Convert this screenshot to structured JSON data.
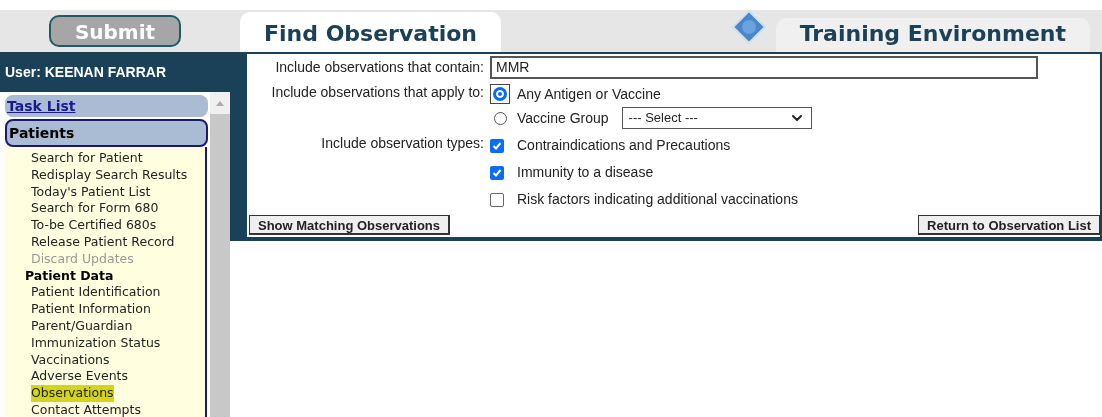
{
  "submit_button": "Submit",
  "tabs": [
    {
      "label": "Find Observation",
      "selected": true
    },
    {
      "label": "Training Environment",
      "selected": false
    }
  ],
  "sidebar": {
    "user": "User: KEENAN FARRAR",
    "task_list": "Task List",
    "section": "Patients",
    "items": [
      {
        "label": "Search for Patient",
        "kind": "link",
        "selected": false
      },
      {
        "label": "Redisplay Search Results",
        "kind": "link",
        "selected": false
      },
      {
        "label": "Today's Patient List",
        "kind": "link",
        "selected": false
      },
      {
        "label": "Search for Form 680",
        "kind": "link",
        "selected": false
      },
      {
        "label": "To-be Certified 680s",
        "kind": "link",
        "selected": false
      },
      {
        "label": "Release Patient Record",
        "kind": "link",
        "selected": false
      },
      {
        "label": "Discard Updates",
        "kind": "disabled",
        "selected": false
      },
      {
        "label": "Patient Data",
        "kind": "heading",
        "selected": false
      },
      {
        "label": "Patient Identification",
        "kind": "link",
        "selected": false
      },
      {
        "label": "Patient Information",
        "kind": "link",
        "selected": false
      },
      {
        "label": "Parent/Guardian",
        "kind": "link",
        "selected": false
      },
      {
        "label": "Immunization Status",
        "kind": "link",
        "selected": false
      },
      {
        "label": "Vaccinations",
        "kind": "link",
        "selected": false
      },
      {
        "label": "Adverse Events",
        "kind": "link",
        "selected": false
      },
      {
        "label": "Observations",
        "kind": "link",
        "selected": true
      },
      {
        "label": "Contact Attempts",
        "kind": "link",
        "selected": false
      }
    ]
  },
  "form": {
    "contain_label": "Include observations that contain:",
    "contain_value": "MMR",
    "apply_label": "Include observations that apply to:",
    "apply_options": [
      {
        "label": "Any Antigen or Vaccine",
        "selected": true
      },
      {
        "label": "Vaccine Group",
        "selected": false,
        "select_value": "--- Select ---"
      }
    ],
    "types_label": "Include observation types:",
    "types": [
      {
        "label": "Contraindications and Precautions",
        "checked": true
      },
      {
        "label": "Immunity to a disease",
        "checked": true
      },
      {
        "label": "Risk factors indicating additional vaccinations",
        "checked": false
      }
    ],
    "buttons": [
      "Show Matching Observations",
      "Return to Observation List"
    ]
  }
}
